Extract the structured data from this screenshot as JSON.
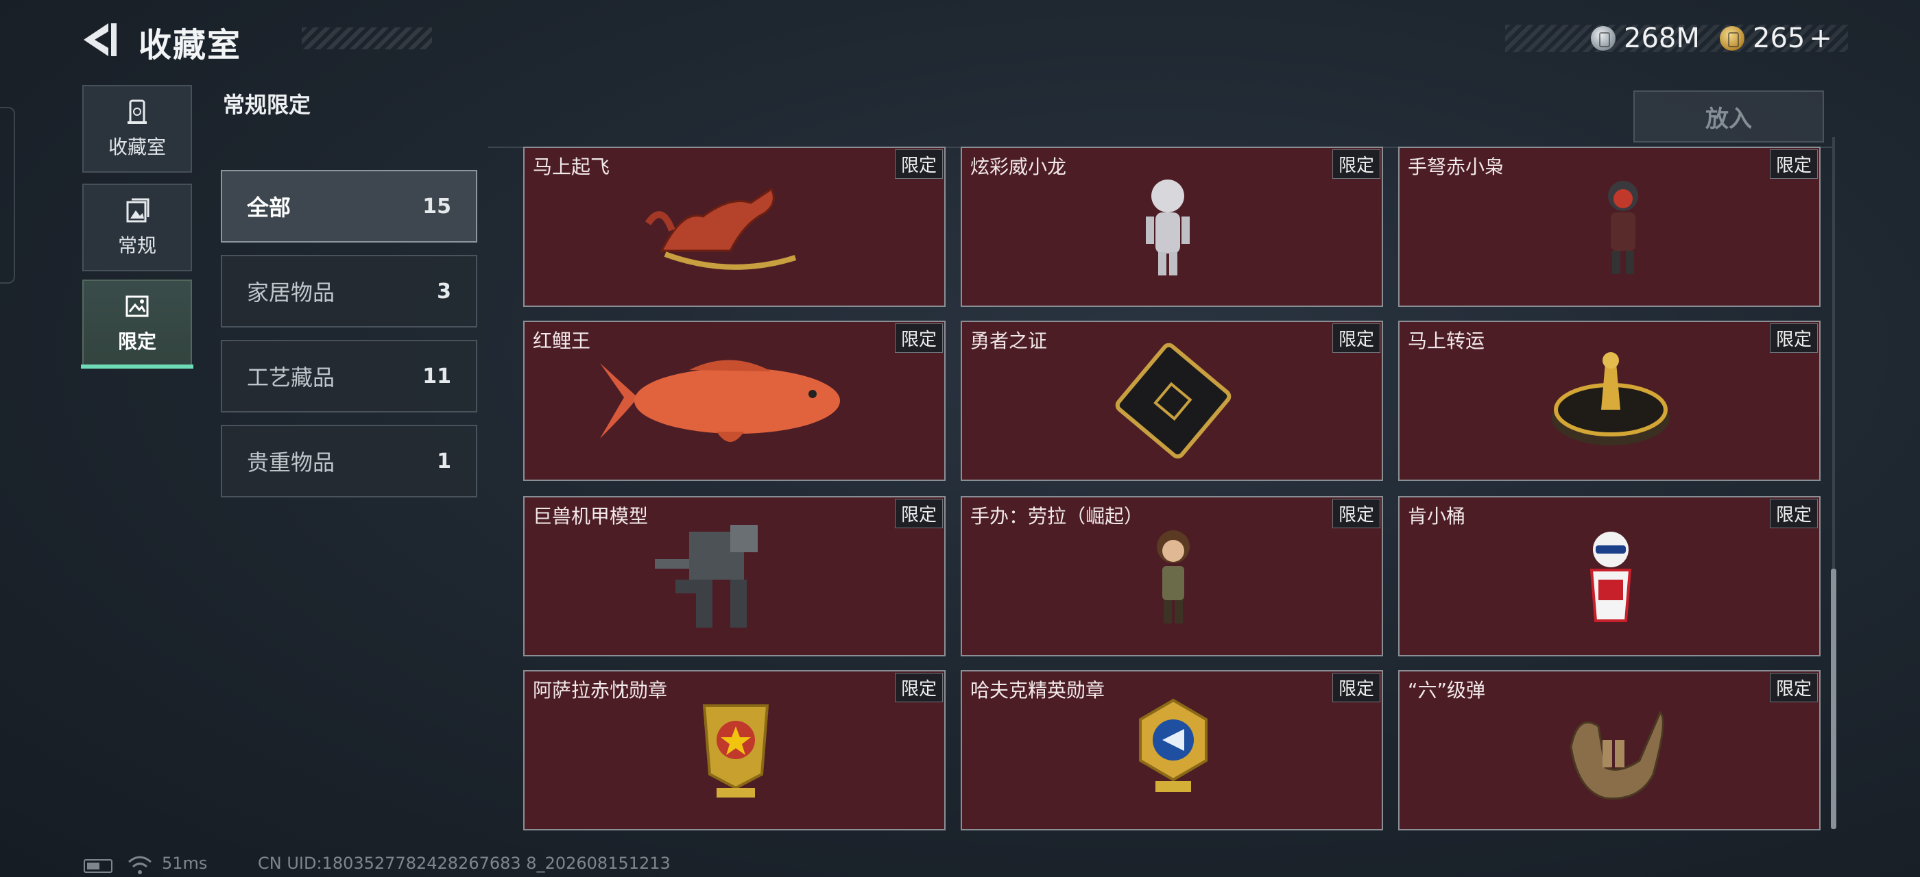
{
  "header": {
    "title": "收藏室"
  },
  "currency": [
    {
      "icon": "silver-coin-icon",
      "value": "268M"
    },
    {
      "icon": "gold-coin-icon",
      "value": "265",
      "plus": "+"
    }
  ],
  "rail": [
    {
      "label": "收藏室",
      "icon": "collection-room-icon",
      "active": false
    },
    {
      "label": "常规",
      "icon": "regular-photo-icon",
      "active": false
    },
    {
      "label": "限定",
      "icon": "limited-image-icon",
      "active": true
    }
  ],
  "section_title": "常规限定",
  "categories": [
    {
      "name": "全部",
      "count": "15",
      "active": true
    },
    {
      "name": "家居物品",
      "count": "3",
      "active": false
    },
    {
      "name": "工艺藏品",
      "count": "11",
      "active": false
    },
    {
      "name": "贵重物品",
      "count": "1",
      "active": false
    }
  ],
  "put_button": "放入",
  "items": [
    {
      "name": "马上起飞",
      "tag": "限定"
    },
    {
      "name": "炫彩威小龙",
      "tag": "限定"
    },
    {
      "name": "手弩赤小枭",
      "tag": "限定"
    },
    {
      "name": "红鲤王",
      "tag": "限定"
    },
    {
      "name": "勇者之证",
      "tag": "限定"
    },
    {
      "name": "马上转运",
      "tag": "限定"
    },
    {
      "name": "巨兽机甲模型",
      "tag": "限定"
    },
    {
      "name": "手办：劳拉（崛起）",
      "tag": "限定"
    },
    {
      "name": "肯小桶",
      "tag": "限定"
    },
    {
      "name": "阿萨拉赤忱勋章",
      "tag": "限定"
    },
    {
      "name": "哈夫克精英勋章",
      "tag": "限定"
    },
    {
      "name": "“六”级弹",
      "tag": "限定"
    }
  ],
  "footer": {
    "ping": "51ms",
    "uid": "CN UID:1803527782428267683 8_202608151213"
  }
}
